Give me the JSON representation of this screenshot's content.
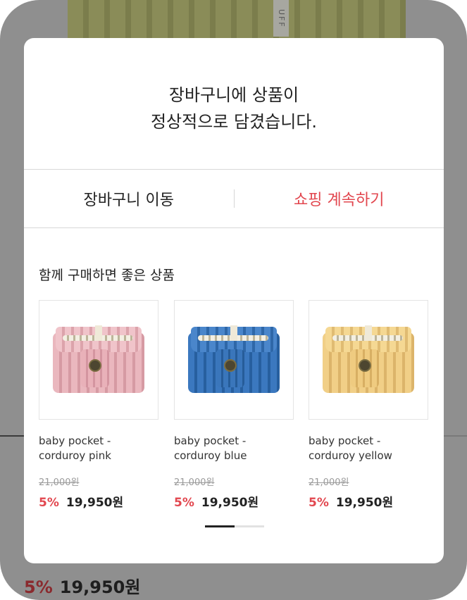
{
  "background": {
    "product_tag_text": "UFF",
    "price": {
      "discount": "5%",
      "amount": "19,950원"
    },
    "colors": {
      "discount": "#8a2a2e",
      "overlay": "#8f8f8f"
    }
  },
  "modal": {
    "message_line1": "장바구니에 상품이",
    "message_line2": "정상적으로 담겼습니다.",
    "actions": {
      "go_to_cart": "장바구니 이동",
      "continue_shopping": "쇼핑 계속하기"
    },
    "colors": {
      "accent": "#e2474f"
    },
    "recommendations": {
      "title": "함께 구매하면 좋은 상품",
      "items": [
        {
          "name_line1": "baby pocket -",
          "name_line2": "corduroy pink",
          "original_price": "21,000원",
          "discount": "5%",
          "price": "19,950원",
          "color": "pink"
        },
        {
          "name_line1": "baby pocket -",
          "name_line2": "corduroy blue",
          "original_price": "21,000원",
          "discount": "5%",
          "price": "19,950원",
          "color": "blue"
        },
        {
          "name_line1": "baby pocket -",
          "name_line2": "corduroy yellow",
          "original_price": "21,000원",
          "discount": "5%",
          "price": "19,950원",
          "color": "yellow"
        }
      ],
      "pager": {
        "current_page": 1,
        "total_pages": 2
      }
    }
  }
}
